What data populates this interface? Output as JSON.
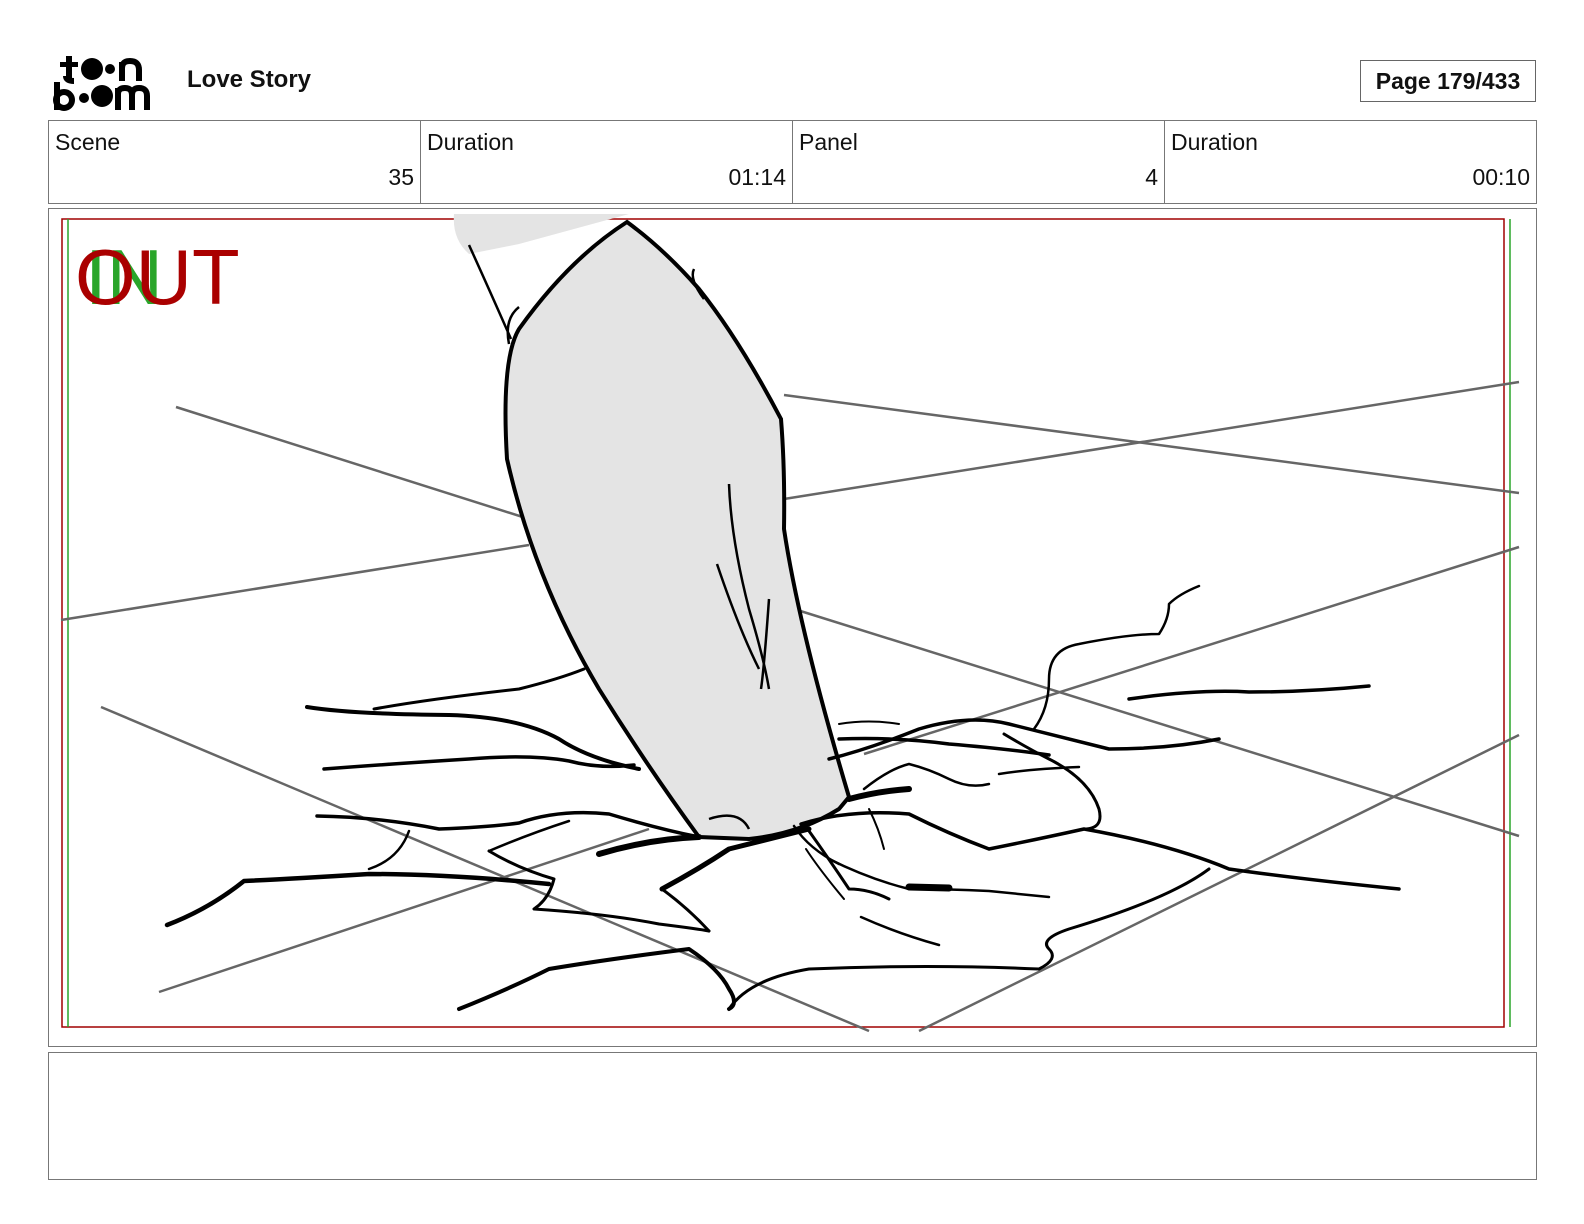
{
  "header": {
    "logo_text": "toon boom",
    "project_title": "Love Story",
    "page_label": "Page 179/433"
  },
  "info": {
    "scene_label": "Scene",
    "scene_value": "35",
    "scene_duration_label": "Duration",
    "scene_duration_value": "01:14",
    "panel_label": "Panel",
    "panel_value": "4",
    "panel_duration_label": "Duration",
    "panel_duration_value": "00:10"
  },
  "panel": {
    "in_mark": "IN",
    "out_mark": "OUT",
    "safe_frame_color": "#a00000",
    "in_color": "#2aa52a",
    "sketch_fill": "#e4e4e4"
  },
  "notes": {
    "text": ""
  }
}
